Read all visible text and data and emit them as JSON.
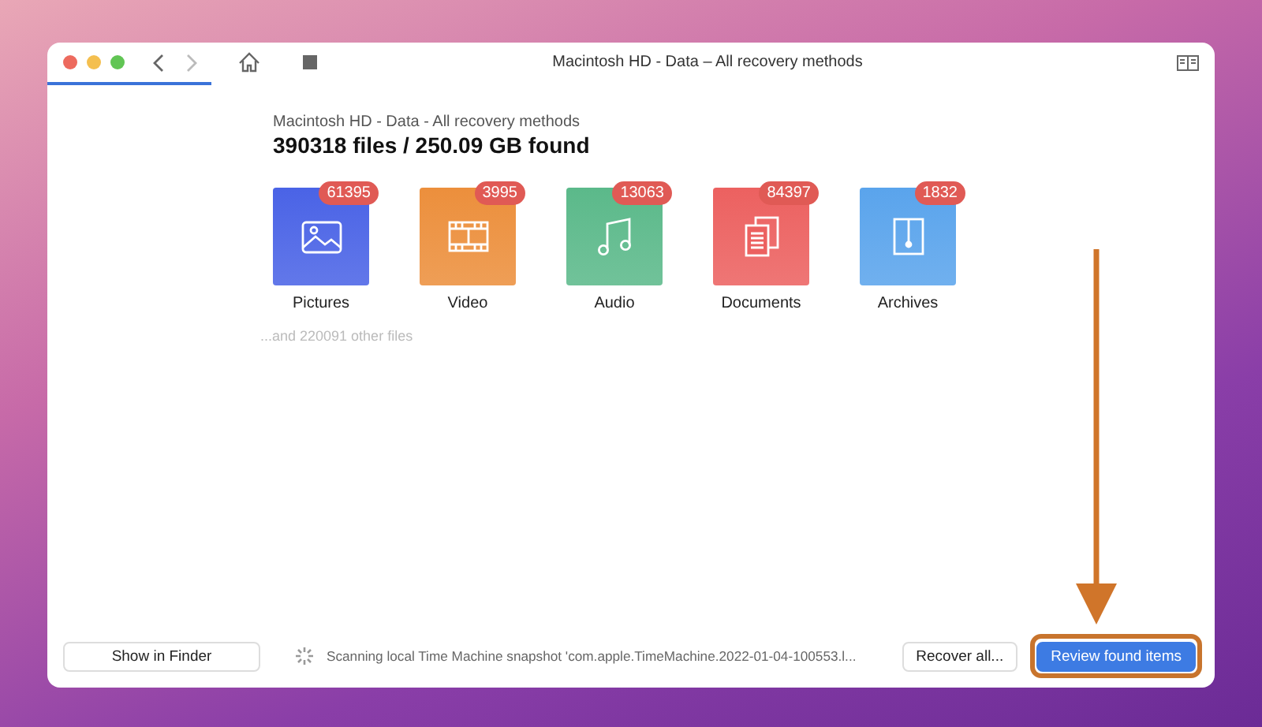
{
  "window": {
    "title": "Macintosh HD - Data – All recovery methods"
  },
  "scan_progress": {
    "level": 0.14
  },
  "summary": {
    "subtitle": "Macintosh HD - Data - All recovery methods",
    "heading": "390318 files / 250.09 GB found"
  },
  "categories": [
    {
      "kind": "pictures",
      "label": "Pictures",
      "count": "61395",
      "color": "#4a63e6"
    },
    {
      "kind": "video",
      "label": "Video",
      "count": "3995",
      "color": "#ec8f3c"
    },
    {
      "kind": "audio",
      "label": "Audio",
      "count": "13063",
      "color": "#5bb98a"
    },
    {
      "kind": "documents",
      "label": "Documents",
      "count": "84397",
      "color": "#ec6160"
    },
    {
      "kind": "archives",
      "label": "Archives",
      "count": "1832",
      "color": "#5aa4ec"
    }
  ],
  "other_files": "...and 220091 other files",
  "bottom_bar": {
    "show_button": "Show in Finder",
    "status": "Scanning local Time Machine snapshot 'com.apple.TimeMachine.2022-01-04-100553.l...",
    "recover_button": "Recover all...",
    "review_button": "Review found items"
  }
}
